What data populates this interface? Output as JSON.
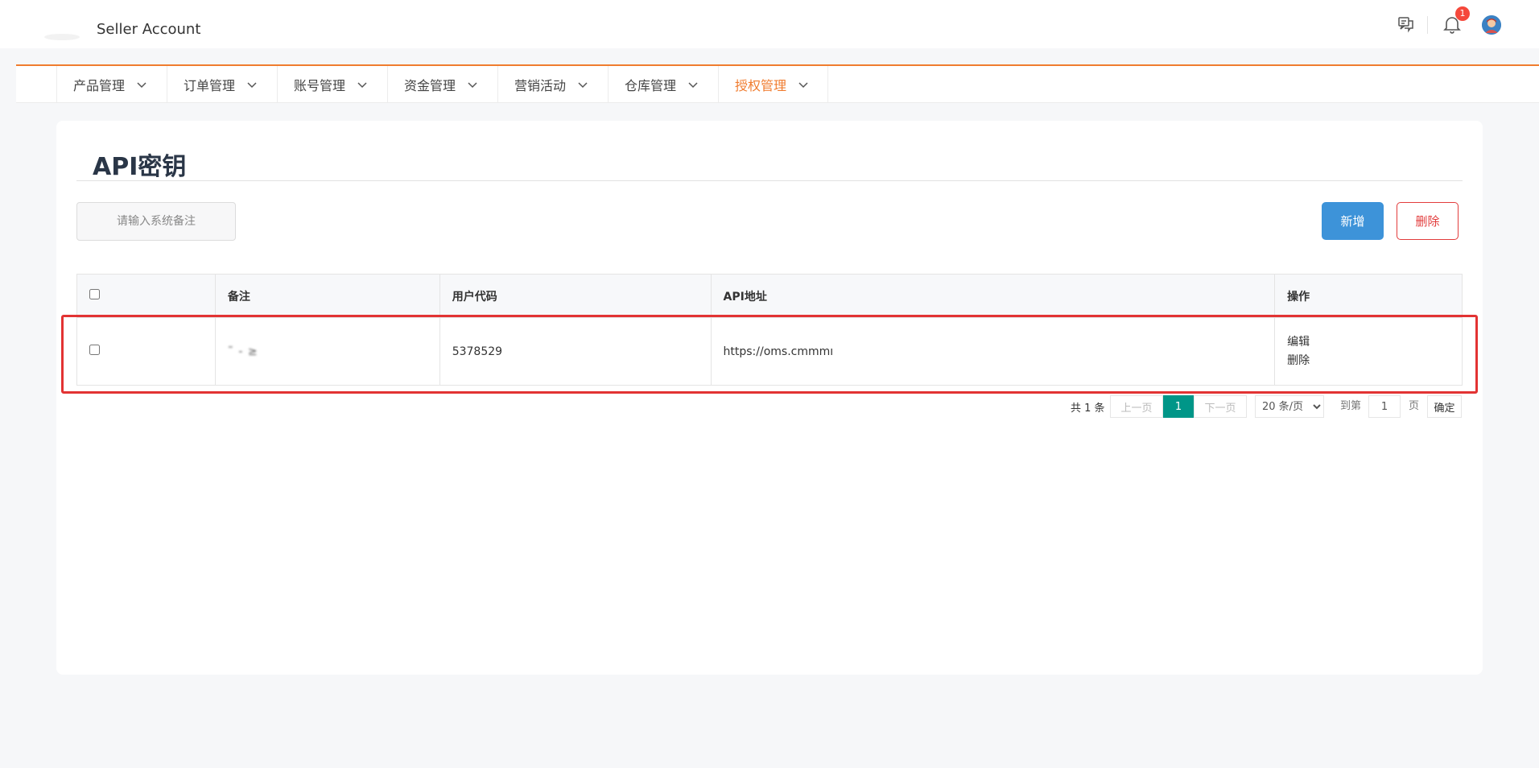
{
  "header": {
    "brand": "Seller Account",
    "notification_count": "1",
    "icons": [
      "chat-icon",
      "bell-icon",
      "avatar"
    ]
  },
  "nav": {
    "items": [
      {
        "label": "产品管理",
        "active": false
      },
      {
        "label": "订单管理",
        "active": false
      },
      {
        "label": "账号管理",
        "active": false
      },
      {
        "label": "资金管理",
        "active": false
      },
      {
        "label": "营销活动",
        "active": false
      },
      {
        "label": "仓库管理",
        "active": false
      },
      {
        "label": "授权管理",
        "active": true
      }
    ]
  },
  "page": {
    "title": "API密钥",
    "search_placeholder": "请输入系统备注",
    "add_label": "新增",
    "delete_label": "删除"
  },
  "table": {
    "headers": {
      "note": "备注",
      "user_code": "用户代码",
      "api_url": "API地址",
      "actions": "操作"
    },
    "rows": [
      {
        "note": "˜ - ≥",
        "user_code": "5378529",
        "api_url": "https://oms.cmmmı",
        "edit_label": "编辑",
        "delete_label": "删除"
      }
    ]
  },
  "pagination": {
    "total_text": "共 1 条",
    "prev_label": "上一页",
    "current_page": "1",
    "next_label": "下一页",
    "page_size_selected": "20 条/页",
    "goto_label": "到第",
    "goto_value": "1",
    "page_unit": "页",
    "confirm_label": "确定"
  },
  "colors": {
    "accent_orange": "#f07c2f",
    "primary_blue": "#3d93d9",
    "danger_red": "#e23c3c",
    "pager_teal": "#009688"
  }
}
